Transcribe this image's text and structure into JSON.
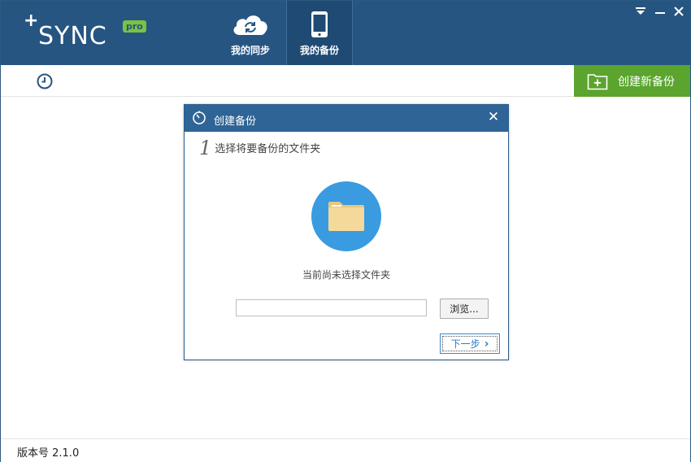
{
  "app": {
    "logo_plus": "+",
    "logo_word": "SYNC",
    "logo_badge": "pro"
  },
  "nav": {
    "tabs": [
      {
        "label": "我的同步",
        "icon": "cloud-sync-icon",
        "active": false
      },
      {
        "label": "我的备份",
        "icon": "phone-icon",
        "active": true
      }
    ]
  },
  "window_controls": {
    "menu_glyph": "▼",
    "minimize_glyph": "—",
    "close_glyph": "✕"
  },
  "toolbar": {
    "history_icon": "clock-icon",
    "new_backup_label": "创建新备份"
  },
  "dialog": {
    "title": "创建备份",
    "close_glyph": "✕",
    "step_number": "1",
    "step_text": "选择将要备份的文件夹",
    "status_text": "当前尚未选择文件夹",
    "path_value": "",
    "browse_label": "浏览...",
    "next_label": "下一步",
    "next_glyph": "›"
  },
  "footer": {
    "version_text": "版本号 2.1.0"
  },
  "colors": {
    "titlebar": "#265582",
    "active_tab": "#1e4a73",
    "new_backup_button": "#5ba42e",
    "dialog_header": "#2f6496",
    "folder_circle": "#3a9be0",
    "folder": "#f5d99a",
    "pro_badge": "#7cc242"
  }
}
